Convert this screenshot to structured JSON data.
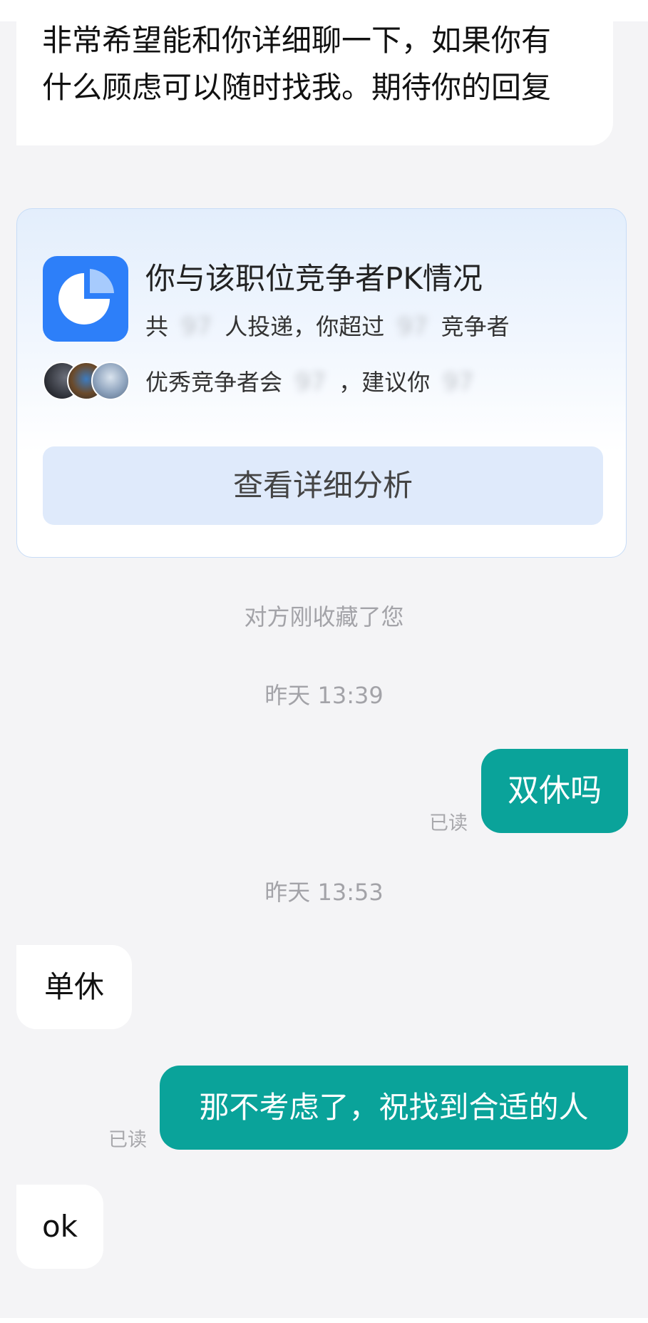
{
  "messages": {
    "first": {
      "line1": "非常希望能和你详细聊一下，如果你有",
      "line2": "什么顾虑可以随时找我。期待你的回复"
    },
    "msg_shuangxiu": "双休吗",
    "msg_danxiu": "单休",
    "msg_reject": "那不考虑了，祝找到合适的人",
    "msg_ok": "ok",
    "read_label": "已读"
  },
  "pk_card": {
    "title": "你与该职位竞争者PK情况",
    "line1_a": "共",
    "line1_blur1": "97",
    "line1_b": "人投递，你超过",
    "line1_blur2": "97",
    "line1_c": "竞争者",
    "line2_a": "优秀竞争者会",
    "line2_blur1": "97",
    "line2_b": "，建议你",
    "line2_blur2": "97",
    "button_label": "查看详细分析",
    "icon": "pie-chart-icon",
    "accent_color": "#2d7ff9"
  },
  "system": {
    "favorited": "对方刚收藏了您",
    "time1": "昨天 13:39",
    "time2": "昨天 13:53"
  },
  "colors": {
    "background": "#f4f4f6",
    "my_bubble": "#0aa39a",
    "their_bubble": "#ffffff"
  }
}
